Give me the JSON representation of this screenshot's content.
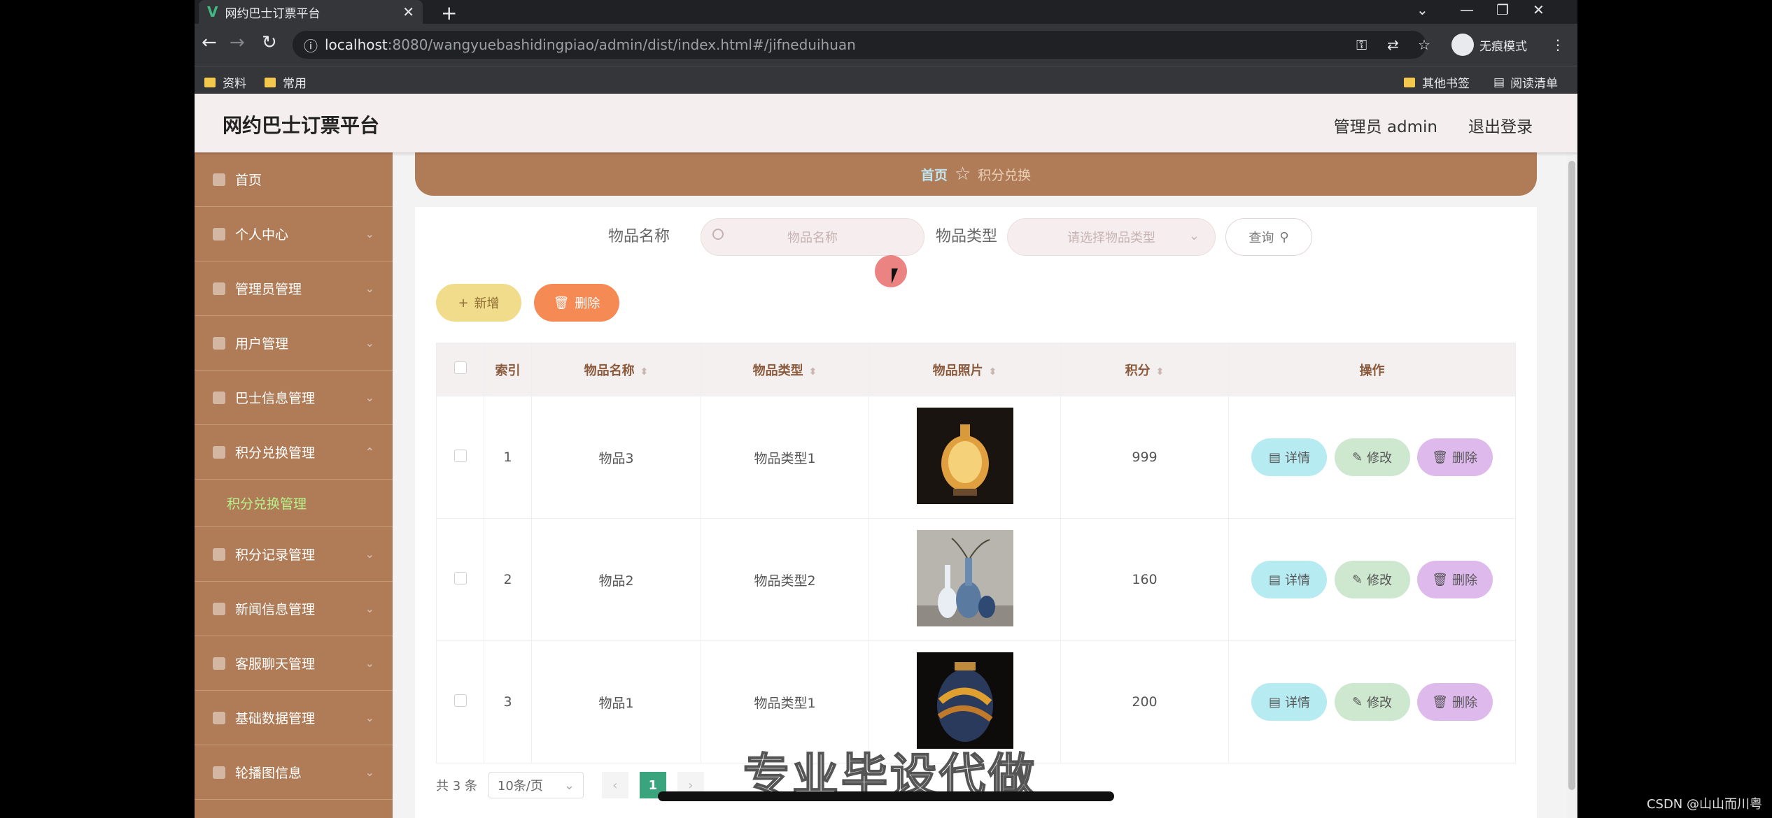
{
  "browser": {
    "tab_title": "网约巴士订票平台",
    "url_host": "localhost",
    "url_path": ":8080/wangyuebashidingpiao/admin/dist/index.html#/jifneduihuan",
    "incognito_label": "无痕模式",
    "bookmarks": [
      "资料",
      "常用"
    ],
    "bookmarks_right": [
      "其他书签",
      "阅读清单"
    ]
  },
  "header": {
    "title": "网约巴士订票平台",
    "user": "管理员 admin",
    "logout": "退出登录"
  },
  "sidebar": {
    "items": [
      {
        "label": "首页"
      },
      {
        "label": "个人中心"
      },
      {
        "label": "管理员管理"
      },
      {
        "label": "用户管理"
      },
      {
        "label": "巴士信息管理"
      },
      {
        "label": "积分兑换管理"
      },
      {
        "label": "积分兑换管理"
      },
      {
        "label": "积分记录管理"
      },
      {
        "label": "新闻信息管理"
      },
      {
        "label": "客服聊天管理"
      },
      {
        "label": "基础数据管理"
      },
      {
        "label": "轮播图信息"
      }
    ]
  },
  "breadcrumb": {
    "home": "首页",
    "current": "积分兑换"
  },
  "filters": {
    "name_label": "物品名称",
    "name_placeholder": "物品名称",
    "type_label": "物品类型",
    "type_placeholder": "请选择物品类型",
    "search_button": "查询"
  },
  "actions": {
    "add": "新增",
    "delete": "删除"
  },
  "table": {
    "headers": [
      "索引",
      "物品名称",
      "物品类型",
      "物品照片",
      "积分",
      "操作"
    ],
    "rows": [
      {
        "index": "1",
        "name": "物品3",
        "type": "物品类型1",
        "points": "999"
      },
      {
        "index": "2",
        "name": "物品2",
        "type": "物品类型2",
        "points": "160"
      },
      {
        "index": "3",
        "name": "物品1",
        "type": "物品类型1",
        "points": "200"
      }
    ],
    "op_detail": "详情",
    "op_edit": "修改",
    "op_delete": "删除"
  },
  "pagination": {
    "total": "共 3 条",
    "page_size": "10条/页",
    "current_page": "1"
  },
  "overlay": {
    "watermark": "专业毕设代做",
    "credit": "CSDN @山山而川粤"
  },
  "colors": {
    "sidebar": "#b07c57",
    "header": "#f5eeee",
    "add_button": "#f0dc8a",
    "delete_button": "#f58a54",
    "detail_button": "#b7ebf2",
    "edit_button": "#cde8cf",
    "row_delete_button": "#ddb9ec",
    "page_active": "#3aa57c"
  }
}
